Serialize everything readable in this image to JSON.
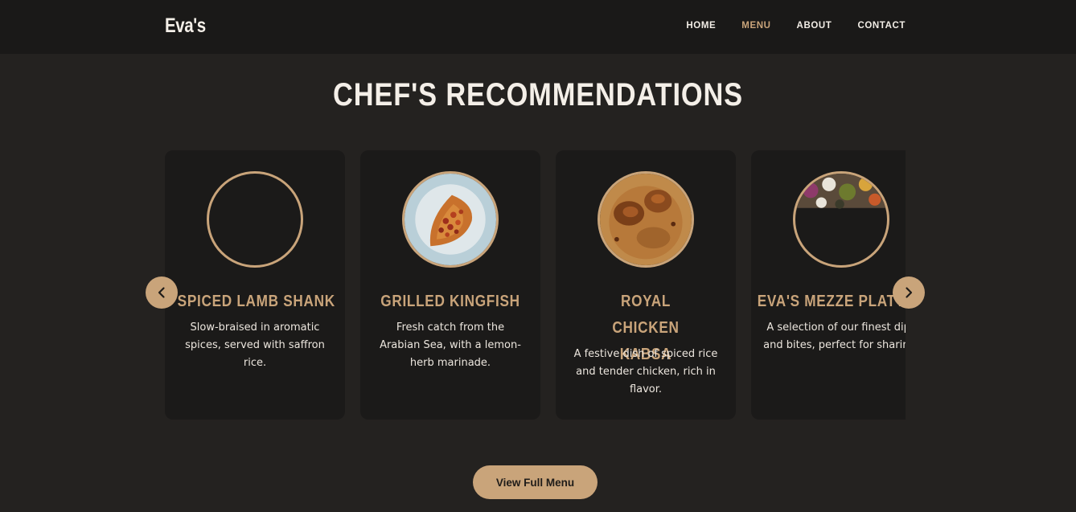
{
  "brand": "Eva's",
  "nav": {
    "items": [
      {
        "label": "HOME",
        "active": false
      },
      {
        "label": "MENU",
        "active": true
      },
      {
        "label": "ABOUT",
        "active": false
      },
      {
        "label": "CONTACT",
        "active": false
      }
    ]
  },
  "section": {
    "title": "CHEF'S RECOMMENDATIONS"
  },
  "cards": [
    {
      "title": "SPICED LAMB SHANK",
      "description": "Slow-braised in aromatic spices, served with saffron rice."
    },
    {
      "title": "GRILLED KINGFISH",
      "description": "Fresh catch from the Arabian Sea, with a lemon-herb marinade."
    },
    {
      "title": "ROYAL CHICKEN KABSA",
      "description": "A festive dish of spiced rice and tender chicken, rich in flavor."
    },
    {
      "title": "EVA'S MEZZE PLATTER",
      "description": "A selection of our finest dips and bites, perfect for sharing."
    }
  ],
  "carousel": {
    "prev_icon": "chevron-left-icon",
    "next_icon": "chevron-right-icon"
  },
  "cta": {
    "label": "View Full Menu"
  },
  "colors": {
    "accent": "#c9a47a",
    "background": "#242220",
    "nav_background": "#1a1918",
    "card_background": "#1b1a19"
  }
}
